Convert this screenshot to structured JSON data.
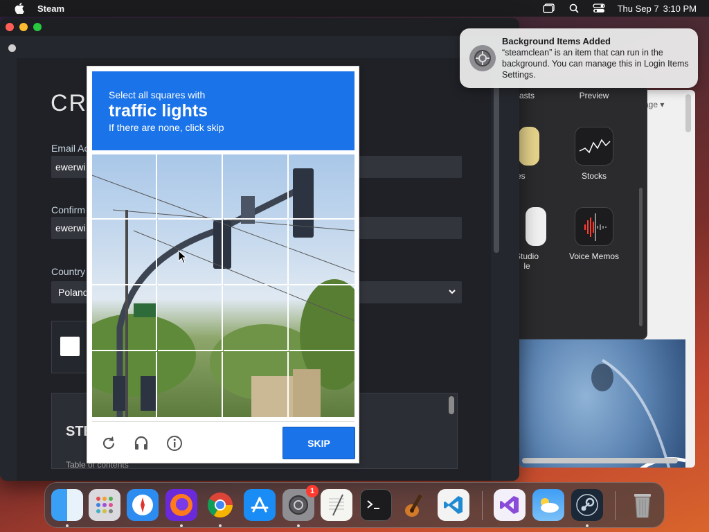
{
  "menubar": {
    "app_name": "Steam",
    "date": "Thu Sep 7",
    "time": "3:10 PM"
  },
  "background_window": {
    "apps": [
      {
        "label": "asts"
      },
      {
        "label": "Preview"
      },
      {
        "label": "ies"
      },
      {
        "label": "Stocks"
      },
      {
        "label": "Studio"
      },
      {
        "label": "le"
      },
      {
        "label": "Voice Memos"
      }
    ],
    "language_label": "age"
  },
  "steam_form": {
    "title": "CRE",
    "email_label": "Email Ac",
    "email_value": "ewerwi",
    "confirm_label": "Confirm",
    "confirm_value": "ewerwi",
    "country_label": "Country",
    "country_value": "Poland",
    "ssa_title": "STE",
    "ssa_sub": "Table of contents"
  },
  "captcha": {
    "instruction": "Select all squares with",
    "target": "traffic lights",
    "hint": "If there are none, click skip",
    "skip_label": "SKIP"
  },
  "notification": {
    "title": "Background Items Added",
    "body": "“steamclean” is an item that can run in the background. You can manage this in Login Items Settings."
  },
  "dock": {
    "system_settings_badge": "1"
  }
}
